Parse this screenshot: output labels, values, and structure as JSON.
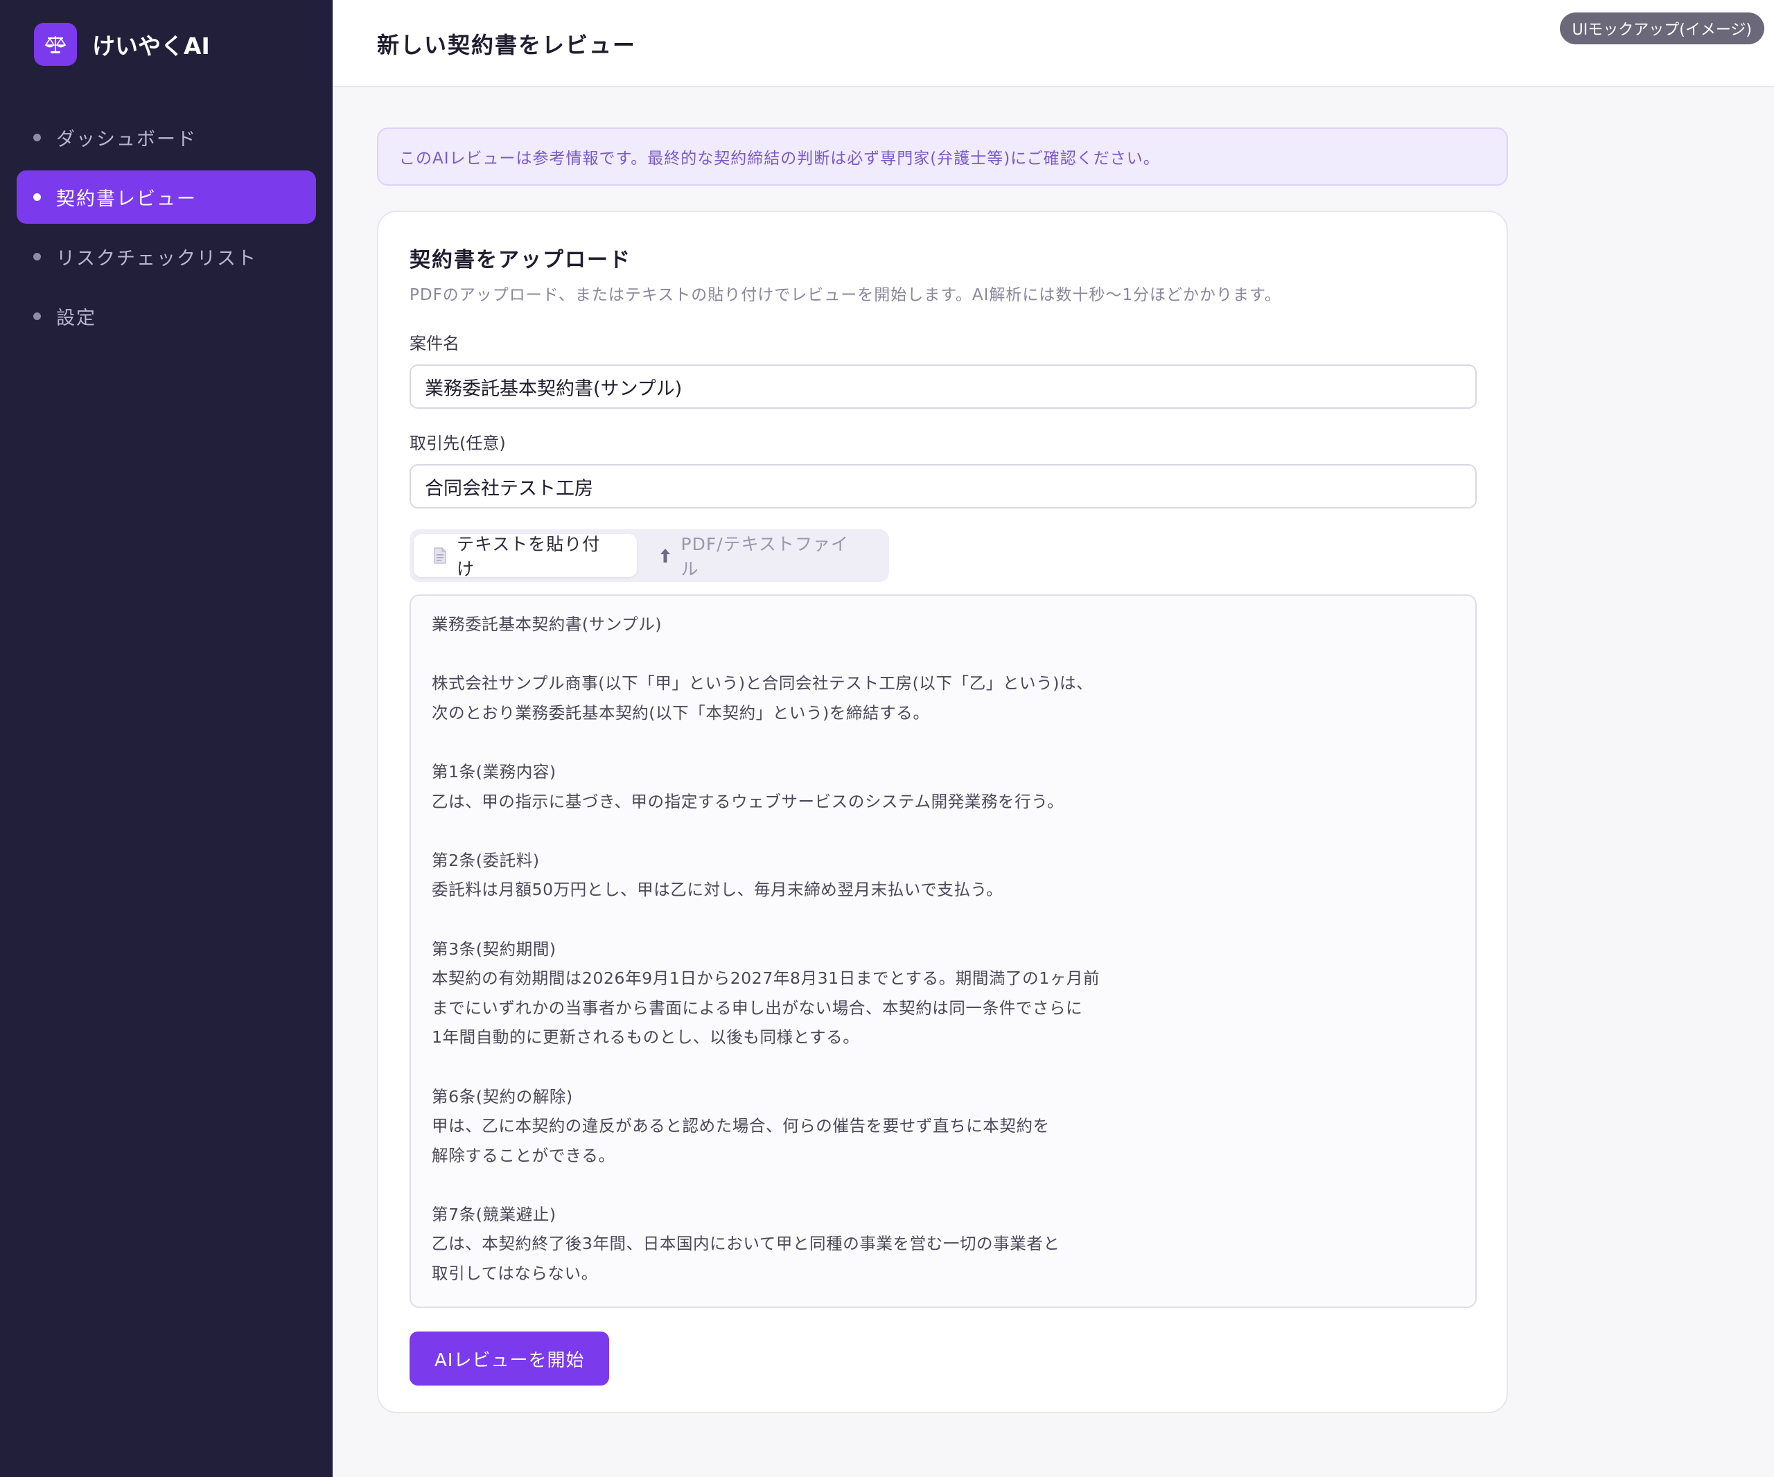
{
  "brand": {
    "name": "けいやくAI",
    "logo_icon": "scales-icon",
    "accent": "#7c3aed"
  },
  "sidebar": {
    "items": [
      {
        "label": "ダッシュボード",
        "active": false
      },
      {
        "label": "契約書レビュー",
        "active": true
      },
      {
        "label": "リスクチェックリスト",
        "active": false
      },
      {
        "label": "設定",
        "active": false
      }
    ]
  },
  "header": {
    "title": "新しい契約書をレビュー",
    "badge": "UIモックアップ(イメージ)"
  },
  "notice": {
    "text": "このAIレビューは参考情報です。最終的な契約締結の判断は必ず専門家(弁護士等)にご確認ください。"
  },
  "upload": {
    "title": "契約書をアップロード",
    "description": "PDFのアップロード、またはテキストの貼り付けでレビューを開始します。AI解析には数十秒〜1分ほどかかります。",
    "case_name_label": "案件名",
    "case_name_value": "業務委託基本契約書(サンプル)",
    "partner_label": "取引先(任意)",
    "partner_value": "合同会社テスト工房",
    "tabs": [
      {
        "label": "テキストを貼り付け",
        "icon": "document-icon",
        "active": true
      },
      {
        "label": "PDF/テキストファイル",
        "icon": "upload-arrow-icon",
        "active": false
      }
    ],
    "contract_text": [
      "業務委託基本契約書(サンプル)",
      "",
      "株式会社サンプル商事(以下「甲」という)と合同会社テスト工房(以下「乙」という)は、",
      "次のとおり業務委託基本契約(以下「本契約」という)を締結する。",
      "",
      "第1条(業務内容)",
      "乙は、甲の指示に基づき、甲の指定するウェブサービスのシステム開発業務を行う。",
      "",
      "第2条(委託料)",
      "委託料は月額50万円とし、甲は乙に対し、毎月末締め翌月末払いで支払う。",
      "",
      "第3条(契約期間)",
      "本契約の有効期間は2026年9月1日から2027年8月31日までとする。期間満了の1ヶ月前",
      "までにいずれかの当事者から書面による申し出がない場合、本契約は同一条件でさらに",
      "1年間自動的に更新されるものとし、以後も同様とする。",
      "",
      "第6条(契約の解除)",
      "甲は、乙に本契約の違反があると認めた場合、何らの催告を要せず直ちに本契約を",
      "解除することができる。",
      "",
      "第7条(競業避止)",
      "乙は、本契約終了後3年間、日本国内において甲と同種の事業を営む一切の事業者と",
      "取引してはならない。"
    ],
    "submit_label": "AIレビューを開始"
  }
}
